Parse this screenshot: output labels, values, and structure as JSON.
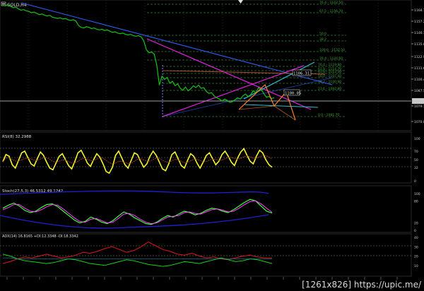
{
  "header": {
    "symbol": "GOLD,H4"
  },
  "icons": {
    "chart_menu": "chart-menu-icon",
    "top_marker": "chevron-down-icon"
  },
  "colors": {
    "background": "#000000",
    "grid": "#1e2a1e",
    "candle": "#11c511",
    "rsi_line": "#f5f52a",
    "fib": "#2f7d2f",
    "trend_blue": "#3060ff",
    "trend_magenta": "#e020e0",
    "trend_brown": "#b05030",
    "trend_cyan": "#30c0d0",
    "orange_pattern": "#ff8030",
    "price_line": "#9aa0a0",
    "adx_red": "#e01818",
    "adx_green": "#18d018",
    "stoch_main": "#40ff40",
    "stoch_signal": "#ff40ff",
    "bb_blue": "#2020d0"
  },
  "main_panel": {
    "price_axis": [
      "1168.70",
      "1157.20",
      "1146.10",
      "1135.00",
      "1122.90",
      "1111.60",
      "1100.45",
      "1087.50",
      "1079.10",
      "1070.80"
    ],
    "fib_levels": [
      "76.4 - 1162.50",
      "67.5 - 1156.70",
      "50.0",
      "38.2",
      "100.0 - 1132.50",
      "76.4 - 1124.60",
      "76.4 - 1119.80",
      "61.8 - 1114.70",
      "61.8 - 1112.50",
      "50.0 - 1107.40",
      "38.2 - 1100.90",
      "23.6 - 1092.80",
      "0.0 - 1081.70"
    ],
    "price_boxes": [
      "1106.31",
      "1100.05"
    ]
  },
  "rsi_panel": {
    "title": "RSI(8) 32.2988",
    "levels": [
      "100",
      "70",
      "50",
      "32",
      "0"
    ]
  },
  "stoch_panel": {
    "title": "Stoch(27,5,3) 46.5312 49.1242",
    "levels": [
      "100",
      "80",
      "20",
      "0"
    ]
  },
  "adx_panel": {
    "title": "ADX(14) 16.8165 +DI:12.3348 -DI:18.3342",
    "levels": [
      "40",
      "30",
      "20",
      "10"
    ]
  },
  "footer": {
    "watermark": "[1261x826] https://upic.me/"
  },
  "chart_data": [
    {
      "type": "line",
      "title": "GOLD,H4",
      "series": [
        {
          "name": "GOLD,H4",
          "values": [
            1168.0,
            1167.5,
            1168.5,
            1167.0,
            1166.0,
            1166.5,
            1165.0,
            1164.0,
            1164.5,
            1163.5,
            1163.0,
            1162.0,
            1162.5,
            1161.5,
            1160.5,
            1161.0,
            1160.0,
            1159.5,
            1160.0,
            1158.5,
            1158.0,
            1157.5,
            1158.0,
            1157.0,
            1157.5,
            1156.5,
            1156.0,
            1156.5,
            1155.5,
            1152.0,
            1150.5,
            1150.0,
            1151.0,
            1150.5,
            1149.5,
            1150.0,
            1149.0,
            1148.5,
            1149.0,
            1148.0,
            1148.5,
            1147.5,
            1146.5,
            1147.0,
            1146.0,
            1145.5,
            1146.0,
            1145.0,
            1144.5,
            1145.0,
            1144.0,
            1143.5,
            1144.0,
            1143.0,
            1140.0,
            1133.0,
            1130.5,
            1131.0,
            1129.5,
            1121.0,
            1105.0,
            1112.0,
            1109.5,
            1111.0,
            1106.5,
            1108.0,
            1104.5,
            1106.0,
            1102.5,
            1101.0,
            1103.5,
            1100.5,
            1102.0,
            1104.5,
            1103.0,
            1105.0,
            1102.5,
            1103.0,
            1100.0,
            1098.5,
            1099.0,
            1096.5,
            1095.0,
            1094.0,
            1092.5,
            1094.0,
            1093.0,
            1091.5,
            1092.0,
            1093.5,
            1095.0,
            1094.0,
            1096.5,
            1098.0,
            1096.0,
            1097.5,
            1100.5,
            1099.0,
            1103.0,
            1101.5,
            1098.5,
            1095.5,
            1096.0,
            1094.5,
            1095.0
          ]
        }
      ],
      "ylim": [
        1070.8,
        1168.7
      ]
    },
    {
      "type": "line",
      "title": "RSI(8) 32.2988",
      "series": [
        {
          "name": "RSI(8)",
          "values": [
            45,
            62,
            58,
            38,
            30,
            48,
            66,
            70,
            55,
            40,
            35,
            52,
            68,
            60,
            44,
            30,
            26,
            42,
            58,
            64,
            50,
            36,
            28,
            46,
            66,
            72,
            58,
            42,
            34,
            50,
            64,
            56,
            40,
            22,
            18,
            32,
            60,
            70,
            54,
            38,
            30,
            48,
            66,
            62,
            46,
            32,
            40,
            58,
            70,
            60,
            44,
            28,
            24,
            40,
            62,
            68,
            52,
            36,
            30,
            48,
            64,
            58,
            42,
            30,
            44,
            60,
            66,
            52,
            38,
            46,
            62,
            70,
            58,
            44,
            36,
            54,
            68,
            76,
            60,
            46,
            40,
            58,
            72,
            66,
            50,
            38,
            32
          ]
        }
      ],
      "ylim": [
        0,
        100
      ]
    },
    {
      "type": "line",
      "title": "Stoch(27,5,3) 46.5312 49.1242",
      "series": [
        {
          "name": "Stoch(27,5,3)",
          "values": [
            60,
            68,
            74,
            66,
            54,
            48,
            52,
            62,
            70,
            72,
            64,
            52,
            40,
            28,
            20,
            24,
            36,
            30,
            22,
            18,
            26,
            38,
            50,
            44,
            34,
            26,
            18,
            16,
            22,
            32,
            40,
            36,
            44,
            52,
            48,
            42,
            46,
            54,
            60,
            58,
            52,
            48,
            56,
            66,
            76,
            84,
            80,
            66,
            52,
            47
          ]
        },
        {
          "name": "Signal",
          "values": [
            56,
            62,
            70,
            70,
            60,
            52,
            50,
            56,
            64,
            70,
            68,
            58,
            46,
            34,
            24,
            22,
            30,
            32,
            26,
            20,
            22,
            32,
            44,
            46,
            40,
            30,
            22,
            18,
            20,
            28,
            36,
            38,
            40,
            48,
            50,
            46,
            44,
            50,
            56,
            58,
            55,
            50,
            52,
            60,
            70,
            78,
            80,
            72,
            60,
            49
          ]
        }
      ],
      "ylim": [
        0,
        100
      ]
    },
    {
      "type": "line",
      "title": "ADX(14) 16.8165 +DI:12.3348 -DI:18.3342",
      "series": [
        {
          "name": "+DI",
          "values": [
            22,
            20,
            17,
            15,
            14,
            13,
            12,
            13,
            15,
            17,
            16,
            14,
            12,
            11,
            10,
            12,
            14,
            16,
            15,
            13,
            11,
            10,
            9,
            10,
            12,
            14,
            13,
            12,
            14,
            16,
            18,
            16,
            14,
            15,
            17,
            16,
            14,
            12
          ]
        },
        {
          "name": "-DI",
          "values": [
            12,
            14,
            17,
            19,
            18,
            20,
            22,
            20,
            18,
            19,
            21,
            24,
            23,
            25,
            28,
            30,
            27,
            24,
            26,
            30,
            35,
            31,
            27,
            25,
            22,
            21,
            23,
            20,
            18,
            19,
            17,
            16,
            18,
            20,
            21,
            19,
            18,
            18
          ]
        },
        {
          "name": "ADX",
          "values": [
            18,
            18,
            17,
            17,
            17,
            17,
            17,
            17,
            17,
            17,
            17,
            17,
            17,
            17,
            17,
            17,
            17,
            17,
            17,
            17,
            17,
            17,
            17,
            17,
            17,
            17,
            17,
            17,
            17,
            17,
            17,
            17,
            17,
            17,
            17,
            17,
            17,
            17
          ]
        }
      ],
      "ylim": [
        0,
        40
      ]
    }
  ]
}
